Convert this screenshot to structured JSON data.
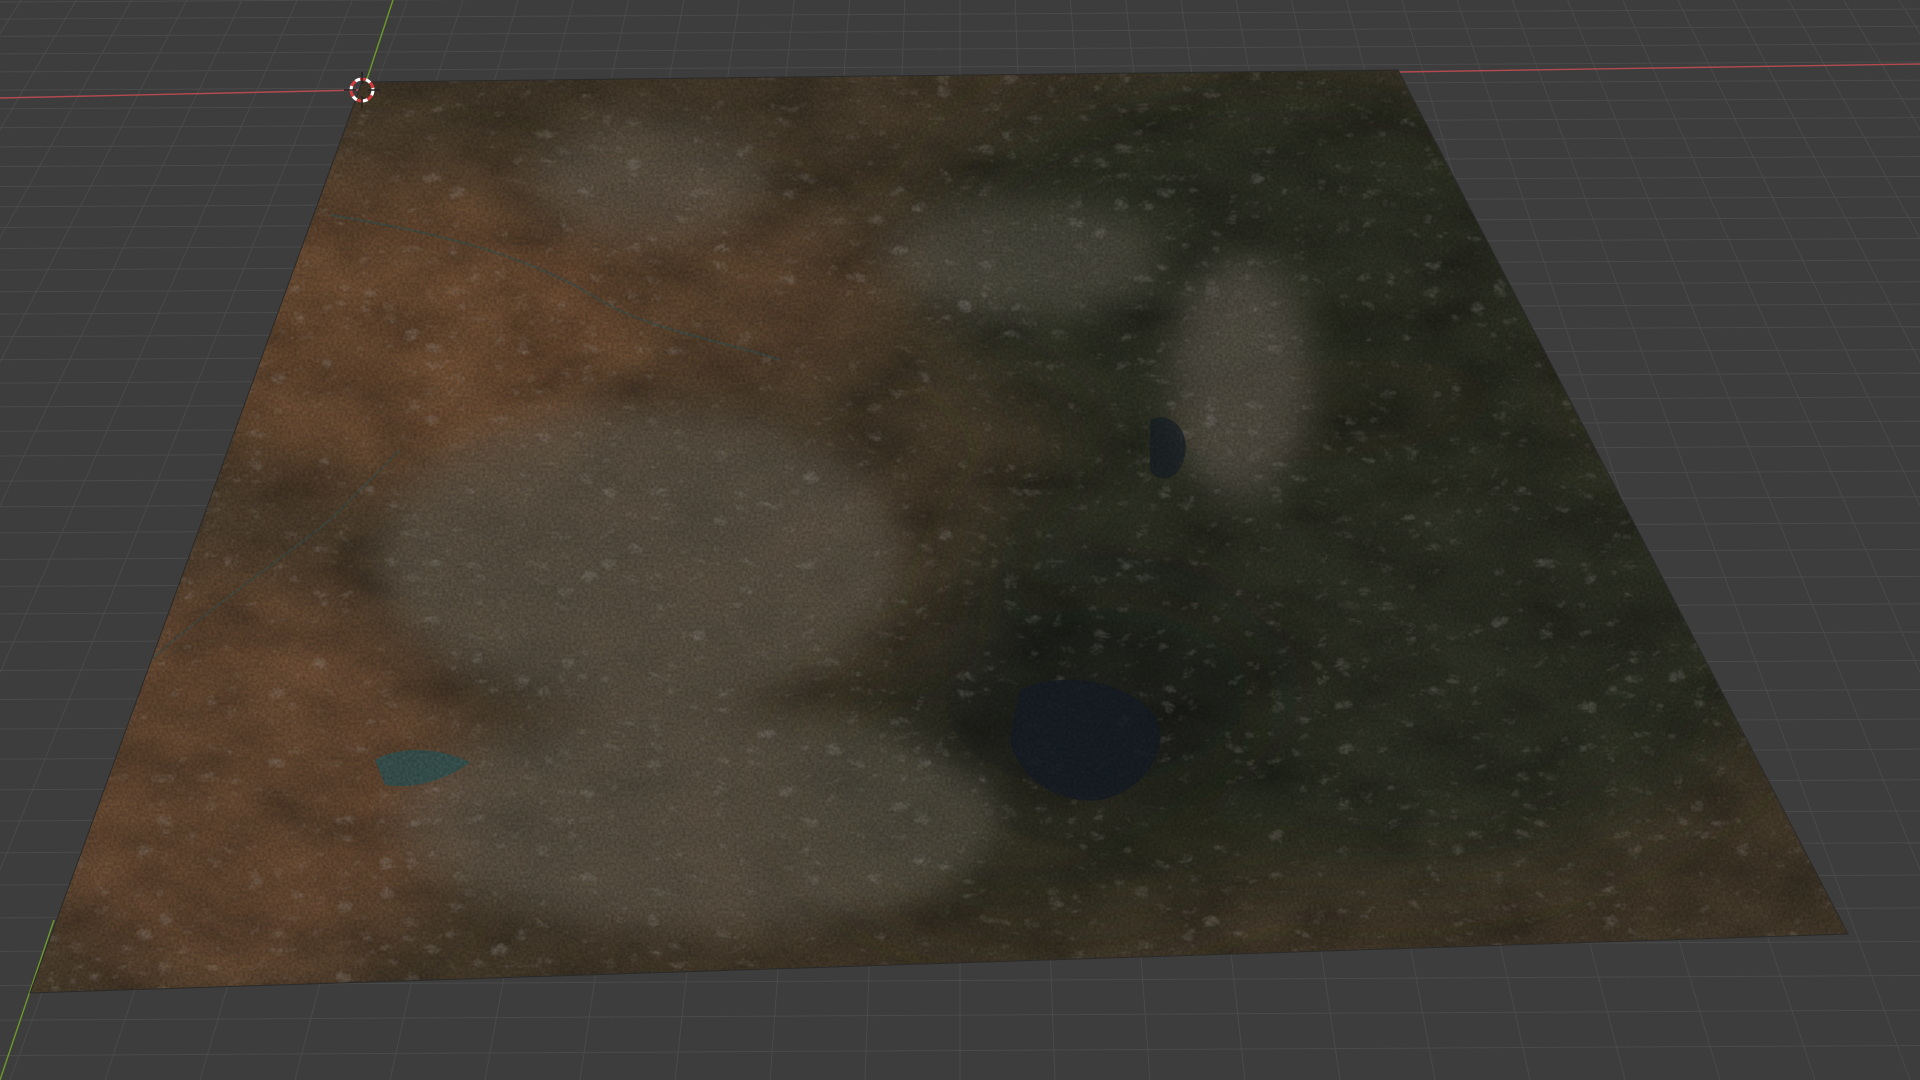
{
  "viewport": {
    "background_color": "#3d3d3d",
    "grid_line_color": "#4a4a4a",
    "x_axis_color": "#b34a4f",
    "y_axis_color": "#6e9a2a"
  },
  "terrain": {
    "object": "terrain-plane",
    "colors": {
      "desert_brown": "#7a5a40",
      "forest_dark": "#2e3428",
      "mountain_rock": "#8f8478",
      "shadow": "#1f241f",
      "lake": "#1c2630",
      "river": "#3e6a6a"
    }
  },
  "cursor": {
    "icon": "3d-cursor-icon",
    "ring_color": "#d33a3a",
    "cross_color": "#222222"
  }
}
